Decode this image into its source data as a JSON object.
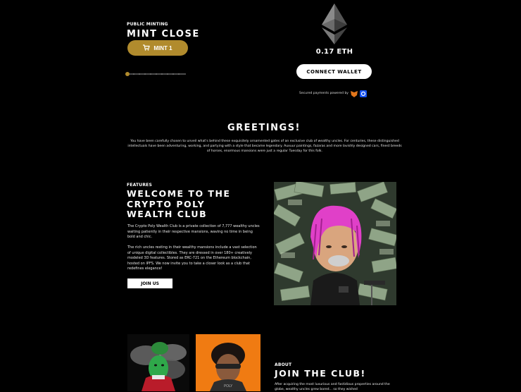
{
  "mint": {
    "kicker": "PUBLIC MINTING",
    "title": "MINT CLOSE",
    "button_label": "MINT 1",
    "price": "0.17 ETH",
    "slider_value": 0
  },
  "wallet": {
    "connect_label": "CONNECT WALLET",
    "secured_text": "Secured payments powered by"
  },
  "greetings": {
    "title": "GREETINGS!",
    "body": "You have been carefully chosen to unveil what's behind these exquisitely ornamented gates of an exclusive club of wealthy uncles. For centuries, these distinguished intellectuals have been adventuring, working, and partying with a style that became legendary. Auxuur paintings, fazaras and more lavishly designed cars, finest breeds of horses, enormous mansions were just a regular Tuesday for this folk."
  },
  "features": {
    "kicker": "FEATURES",
    "title_lines": [
      "WELCOME TO THE",
      "CRYPTO POLY",
      "WEALTH CLUB"
    ],
    "para1": "The Crypto Poly Wealth Club is a private collection of 7,777 wealthy uncles waiting patiently in their respective mansions, waving no time in being bold and chic.",
    "para2": "The rich uncles resting in their wealthy mansions include a vast selection of unique digital collectibles. They are dressed in over 180+ creatively modeled 3D features. Stored as ERC-721 on the Ethereum blockchain, hosted on IPFS. We now invite you to take a closer look as a club that redefines elegance!",
    "button_label": "JOIN US"
  },
  "about": {
    "kicker": "ABOUT",
    "title": "JOIN THE CLUB!",
    "body": "After acquiring the most luxurious and fastidious properties around the globe, wealthy uncles grew bored... so they wished"
  },
  "colors": {
    "gold": "#b18b2d",
    "background": "#000000",
    "hair_pink": "#e040c8",
    "orange_card": "#f07b12"
  }
}
